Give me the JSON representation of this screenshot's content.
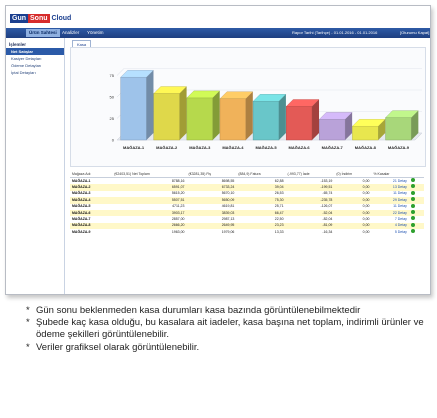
{
  "app": {
    "logo_part1": "Gun",
    "logo_part2": "Sonu",
    "logo_part3": "Cloud"
  },
  "nav": {
    "tabs": [
      "Ürün Sahtesi",
      "Analizler",
      "Yönetim"
    ],
    "info": "Rapor Tarihi (Tarihçe) - 01.01.2016 - 01.01.2016",
    "logout": "[Oturumu Kapat]"
  },
  "sidebar": {
    "title": "İşlemler",
    "items": [
      "Net Satışlar",
      "Kasiyer Detayları",
      "Ödeme Detayları",
      "İptal Detayları"
    ]
  },
  "content": {
    "tab": "Kasa"
  },
  "chart_data": {
    "type": "bar",
    "categories": [
      "MAĞAZA-1",
      "MAĞAZA-2",
      "MAĞAZA-3",
      "MAĞAZA-4",
      "MAĞAZA-5",
      "MAĞAZA-6",
      "MAĞAZA-7",
      "MAĞAZA-8",
      "MAĞAZA-9"
    ],
    "values": [
      73,
      54,
      49,
      48,
      45,
      39,
      24,
      16,
      26
    ],
    "yticks": [
      "75",
      "50",
      "25",
      "0"
    ],
    "ylim": [
      0,
      100
    ],
    "colors": [
      "#9ec3ea",
      "#dfd84a",
      "#b6d94c",
      "#f0b25a",
      "#69c6c9",
      "#e35a56",
      "#b9a2d9",
      "#e8e64e",
      "#a8d77a"
    ]
  },
  "table": {
    "headers": [
      "Mağaza Adı",
      "(€2403,51) Net Toplam",
      "(€3281,35) Fiş",
      "(884,9) Fatura",
      "(-993,77) İade",
      "(0) İndirim",
      "% Kasalar",
      ""
    ],
    "rows": [
      [
        "MAĞAZA-1",
        "8788,16",
        "8698,55",
        "62,88",
        "-153,19",
        "0,00",
        "21 Detay"
      ],
      [
        "MAĞAZA-2",
        "6591,07",
        "6733,24",
        "39,04",
        "-199,51",
        "0,00",
        "13 Detay"
      ],
      [
        "MAĞAZA-3",
        "5615,20",
        "5670,10",
        "26,53",
        "-65,74",
        "0,00",
        "11 Detay"
      ],
      [
        "MAĞAZA-4",
        "5507,51",
        "5650,09",
        "75,30",
        "-235,78",
        "0,00",
        "29 Detay"
      ],
      [
        "MAĞAZA-5",
        "4711,23",
        "4619,81",
        "25,71",
        "-126,07",
        "0,00",
        "11 Detay"
      ],
      [
        "MAĞAZA-6",
        "3903,17",
        "3839,03",
        "66,47",
        "-52,04",
        "0,00",
        "22 Detay"
      ],
      [
        "MAĞAZA-7",
        "2857,00",
        "2987,13",
        "22,50",
        "-82,04",
        "0,00",
        "7 Detay"
      ],
      [
        "MAĞAZA-8",
        "2666,20",
        "2649,95",
        "23,23",
        "-81,09",
        "0,00",
        "4 Detay"
      ],
      [
        "MAĞAZA-9",
        "1963,00",
        "1979,06",
        "13,33",
        "-16,34",
        "0,00",
        "5 Detay"
      ]
    ]
  },
  "notes": [
    "Gün sonu beklenmeden kasa durumları kasa bazında görüntülenebilmektedir",
    "Şubede kaç kasa olduğu, bu kasalara ait iadeler, kasa başına net toplam, indirimli ürünler ve ödeme şekilleri görüntülenebilir.",
    "Veriler grafiksel olarak görüntülenebilir."
  ],
  "note_bullet": "*"
}
